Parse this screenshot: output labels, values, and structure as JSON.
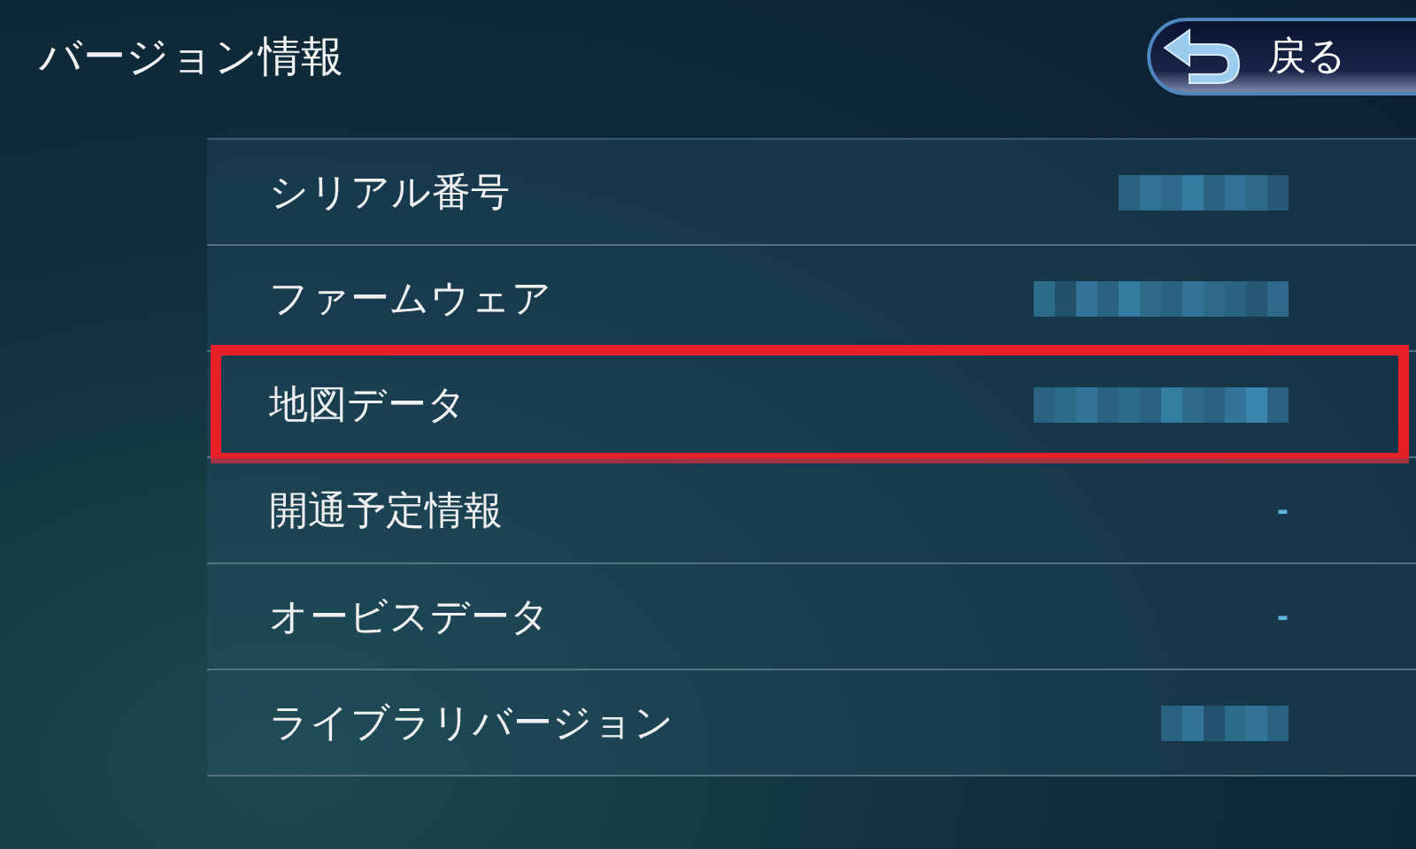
{
  "header": {
    "title": "バージョン情報",
    "back_button": "戻る"
  },
  "rows": [
    {
      "label": "シリアル番号",
      "kind": "redacted",
      "highlighted": false
    },
    {
      "label": "ファームウェア",
      "kind": "redacted",
      "highlighted": false
    },
    {
      "label": "地図データ",
      "kind": "redacted",
      "highlighted": true
    },
    {
      "label": "開通予定情報",
      "kind": "text",
      "value": "-",
      "highlighted": false
    },
    {
      "label": "オービスデータ",
      "kind": "text",
      "value": "-",
      "highlighted": false
    },
    {
      "label": "ライブラリバージョン",
      "kind": "redacted",
      "highlighted": false
    }
  ]
}
